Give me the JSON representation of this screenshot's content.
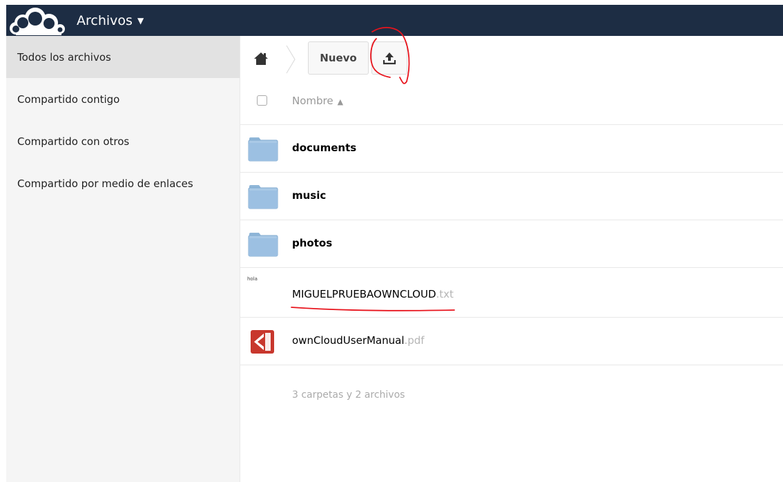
{
  "header": {
    "app_name": "Archivos",
    "caret": "▼",
    "background": "#1d2d44"
  },
  "sidebar": {
    "items": [
      {
        "label": "Todos los archivos",
        "active": true
      },
      {
        "label": "Compartido contigo",
        "active": false
      },
      {
        "label": "Compartido con otros",
        "active": false
      },
      {
        "label": "Compartido por medio de enlaces",
        "active": false
      }
    ]
  },
  "controls": {
    "new_label": "Nuevo",
    "upload_icon": "upload-icon",
    "home_icon": "home-icon"
  },
  "list": {
    "column_name": "Nombre",
    "sort_indicator": "▲",
    "rows": [
      {
        "type": "folder",
        "name": "documents",
        "ext": ""
      },
      {
        "type": "folder",
        "name": "music",
        "ext": ""
      },
      {
        "type": "folder",
        "name": "photos",
        "ext": ""
      },
      {
        "type": "file",
        "name": "MIGUELPRUEBAOWNCLOUD",
        "ext": ".txt",
        "thumbnail_text": "hola"
      },
      {
        "type": "file",
        "name": "ownCloudUserManual",
        "ext": ".pdf"
      }
    ],
    "summary": "3 carpetas y 2 archivos"
  },
  "annotations": {
    "color": "#e8141d"
  }
}
